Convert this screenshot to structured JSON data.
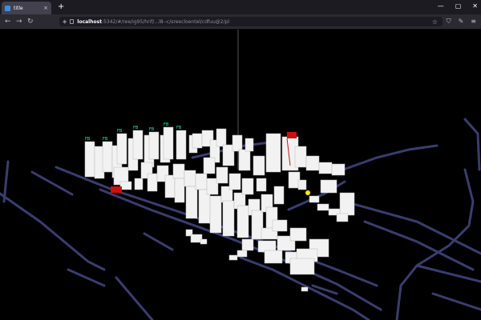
{
  "browser": {
    "tab_title": "title",
    "tab_close": "×",
    "new_tab": "+",
    "window_controls": [
      "—",
      "▢",
      "✕"
    ],
    "nav": {
      "back": "←",
      "forward": "→",
      "reload": "↻"
    },
    "url_host": "localhost",
    "url_rest": ":5342/#/ree/ig95/hrif/...l8--c/sreecloentel/cdfuu@2/pl",
    "toolbar_icons": [
      "shield-icon",
      "extensions-icon",
      "menu-icon"
    ]
  },
  "scene": {
    "description_kind": "3d-city-visualization",
    "building_tags": [
      "FB",
      "FB",
      "FB",
      "FB",
      "FB",
      "FB",
      "FB"
    ],
    "colors": {
      "background": "#000000",
      "building": "#ffffff",
      "road": "#3a3d6e",
      "tag": "#2ee8c8",
      "highlight": "#cc1111",
      "marker": "#ffee00"
    }
  }
}
